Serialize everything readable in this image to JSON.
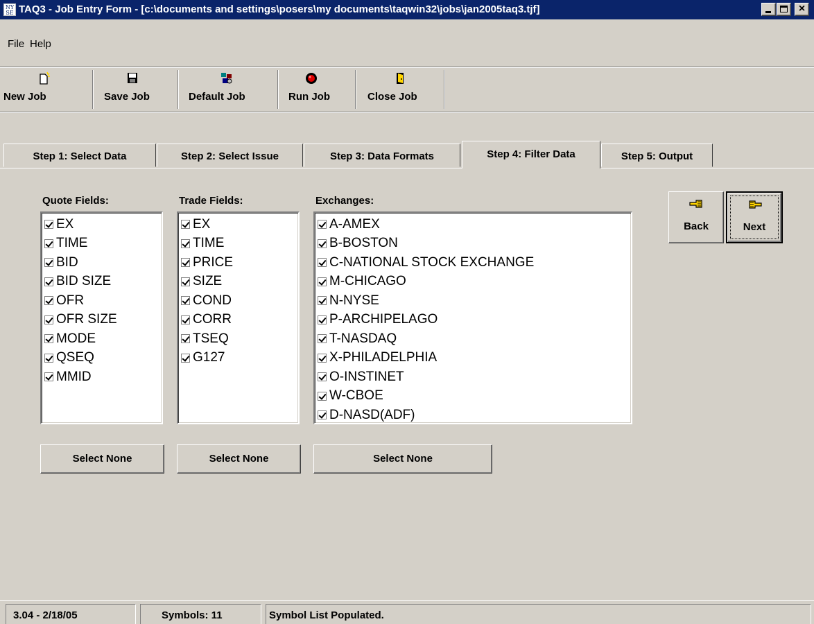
{
  "window": {
    "logo_text": "NY SE",
    "title": "TAQ3 - Job Entry Form - [c:\\documents and settings\\posers\\my documents\\taqwin32\\jobs\\jan2005taq3.tjf]",
    "minimize": "minimize",
    "maximize": "maximize",
    "close": "×"
  },
  "menu": {
    "file": "File",
    "help": "Help"
  },
  "toolbar": {
    "new_job": "New Job",
    "save_job": "Save Job",
    "default_job": "Default Job",
    "run_job": "Run Job",
    "close_job": "Close Job"
  },
  "tabs": [
    "Step 1: Select Data",
    "Step 2: Select Issue",
    "Step 3: Data Formats",
    "Step 4: Filter Data",
    "Step 5: Output"
  ],
  "active_tab_index": 3,
  "quote_fields": {
    "label": "Quote Fields:",
    "items": [
      "EX",
      "TIME",
      "BID",
      "BID SIZE",
      "OFR",
      "OFR SIZE",
      "MODE",
      "QSEQ",
      "MMID"
    ],
    "select_none": "Select None"
  },
  "trade_fields": {
    "label": "Trade Fields:",
    "items": [
      "EX",
      "TIME",
      "PRICE",
      "SIZE",
      "COND",
      "CORR",
      "TSEQ",
      "G127"
    ],
    "select_none": "Select None"
  },
  "exchanges": {
    "label": "Exchanges:",
    "items": [
      "A-AMEX",
      "B-BOSTON",
      "C-NATIONAL STOCK EXCHANGE",
      "M-CHICAGO",
      "N-NYSE",
      "P-ARCHIPELAGO",
      "T-NASDAQ",
      "X-PHILADELPHIA",
      "O-INSTINET",
      "W-CBOE",
      "D-NASD(ADF)"
    ],
    "select_none": "Select None"
  },
  "nav": {
    "back": "Back",
    "next": "Next"
  },
  "status": {
    "version": "3.04 - 2/18/05",
    "symbols": "Symbols: 11",
    "message": "Symbol List Populated."
  },
  "colors": {
    "titlebar": "#0a246a",
    "face": "#d4d0c8"
  }
}
